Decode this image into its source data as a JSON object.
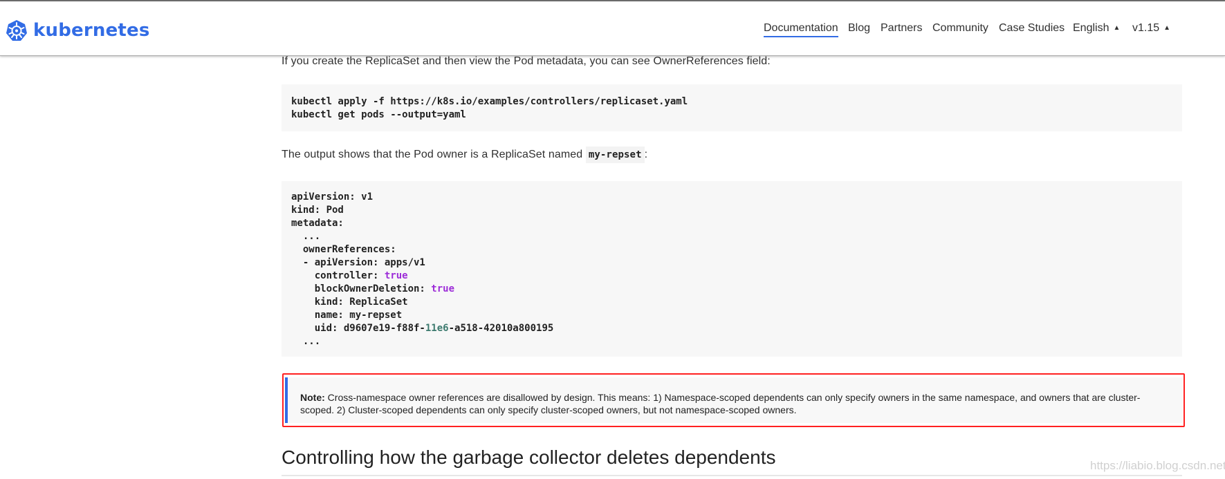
{
  "header": {
    "brand": "kubernetes",
    "nav": [
      {
        "label": "Documentation",
        "active": true
      },
      {
        "label": "Blog"
      },
      {
        "label": "Partners"
      },
      {
        "label": "Community"
      },
      {
        "label": "Case Studies"
      },
      {
        "label": "English",
        "dropdown": true
      },
      {
        "label": "v1.15",
        "dropdown": true
      }
    ],
    "accent_color": "#326ce5"
  },
  "content": {
    "intro": "If you create the ReplicaSet and then view the Pod metadata, you can see OwnerReferences field:",
    "command_lines": [
      "kubectl apply -f https://k8s.io/examples/controllers/replicaset.yaml",
      "kubectl get pods --output=yaml"
    ],
    "output_text_before": "The output shows that the Pod owner is a ReplicaSet named ",
    "output_code": "my-repset",
    "output_text_after": ":",
    "yaml_lines": [
      "apiVersion: v1",
      "kind: Pod",
      "metadata:",
      "  ...",
      "  ownerReferences:",
      "  - apiVersion: apps/v1",
      "    controller: ",
      "    blockOwnerDeletion: ",
      "    kind: ReplicaSet",
      "    name: my-repset",
      "    uid: d9607e19-f88f-",
      "  ..."
    ],
    "yaml_true": "true",
    "uid_num": "11e6",
    "uid_tail": "-a518-42010a800195",
    "note_label": "Note:",
    "note_text": " Cross-namespace owner references are disallowed by design. This means: 1) Namespace-scoped dependents can only specify owners in the same namespace, and owners that are cluster-scoped. 2) Cluster-scoped dependents can only specify cluster-scoped owners, but not namespace-scoped owners.",
    "section_title": "Controlling how the garbage collector deletes dependents"
  },
  "watermark": "https://liabio.blog.csdn.net"
}
